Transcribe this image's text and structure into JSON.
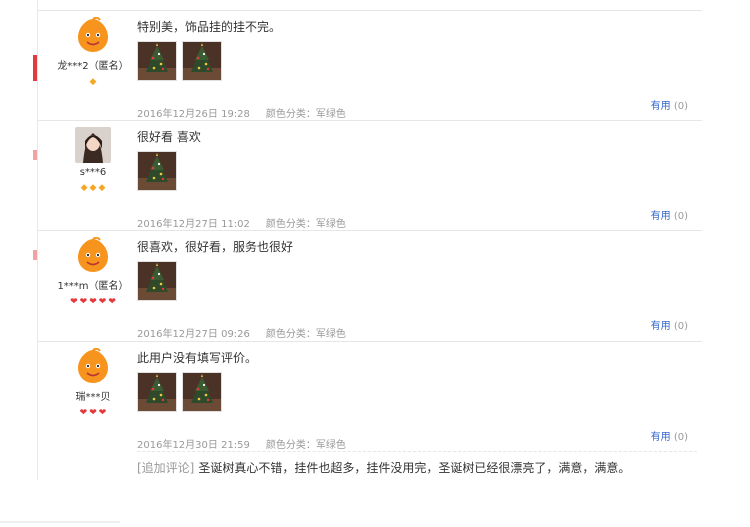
{
  "reviews": [
    {
      "username": "龙***2（匿名）",
      "avatar": "orange-mascot",
      "badge_icon": "diamond",
      "badge_count": 1,
      "text": "特别美，饰品挂的挂不完。",
      "images": [
        "tree-photo",
        "tree-photo"
      ],
      "date": "2016年12月26日 19:28",
      "spec": "颜色分类：军绿色",
      "useful_label": "有用",
      "useful_count": "(0)"
    },
    {
      "username": "s***6",
      "avatar": "user-photo",
      "badge_icon": "diamond",
      "badge_count": 3,
      "text": "很好看 喜欢",
      "images": [
        "tree-photo"
      ],
      "date": "2016年12月27日 11:02",
      "spec": "颜色分类：军绿色",
      "useful_label": "有用",
      "useful_count": "(0)"
    },
    {
      "username": "1***m（匿名）",
      "avatar": "orange-mascot",
      "badge_icon": "heart",
      "badge_count": 5,
      "text": "很喜欢，很好看，服务也很好",
      "images": [
        "tree-photo"
      ],
      "date": "2016年12月27日 09:26",
      "spec": "颜色分类：军绿色",
      "useful_label": "有用",
      "useful_count": "(0)"
    },
    {
      "username": "瑞***贝",
      "avatar": "orange-mascot",
      "badge_icon": "heart",
      "badge_count": 3,
      "text": "此用户没有填写评价。",
      "images": [
        "tree-photo",
        "tree-photo"
      ],
      "date": "2016年12月30日 21:59",
      "spec": "颜色分类：军绿色",
      "useful_label": "有用",
      "useful_count": "(0)"
    }
  ],
  "followup": {
    "tag": "[追加评论]",
    "text": "圣诞树真心不错，挂件也超多，挂件没用完，圣诞树已经很漂亮了，满意，满意。"
  },
  "colors": {
    "link": "#3366cc",
    "meta": "#999999",
    "accent": "#e4393c",
    "mascot": "#f7941d",
    "diamond": "#f5a623"
  }
}
